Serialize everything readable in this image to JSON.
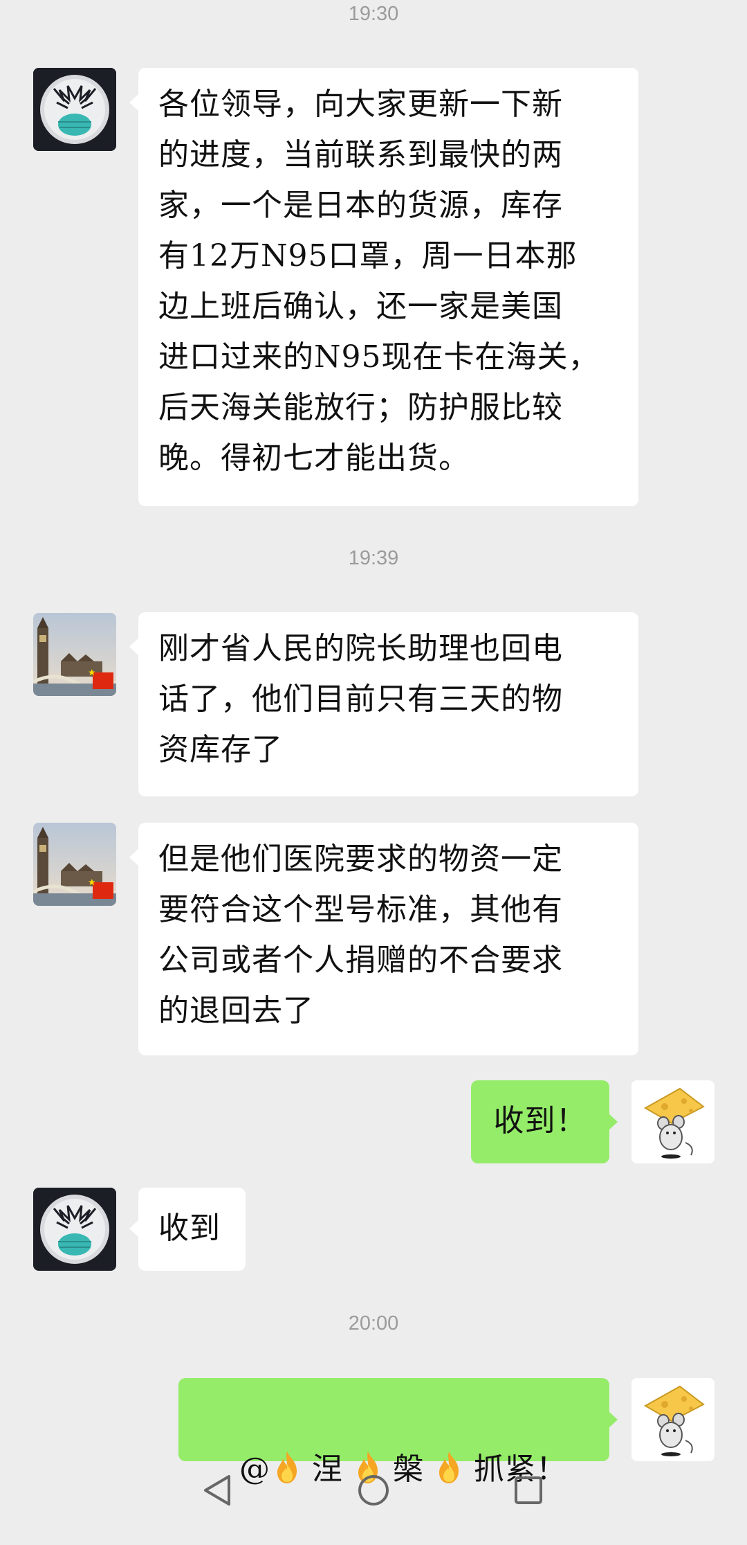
{
  "chat": {
    "messages": [
      {
        "type": "time",
        "text": "19:30"
      },
      {
        "type": "in",
        "sender": "mask-avatar",
        "text": "各位领导，向大家更新一下新\n的进度，当前联系到最快的两\n家，一个是日本的货源，库存\n有12万N95口罩，周一日本那\n边上班后确认，还一家是美国\n进口过来的N95现在卡在海关，\n后天海关能放行；防护服比较\n晚。得初七才能出货。"
      },
      {
        "type": "time",
        "text": "19:39"
      },
      {
        "type": "in",
        "sender": "london-avatar",
        "text": "刚才省人民的院长助理也回电\n话了，他们目前只有三天的物\n资库存了"
      },
      {
        "type": "in",
        "sender": "london-avatar",
        "text": "但是他们医院要求的物资一定\n要符合这个型号标准，其他有\n公司或者个人捐赠的不合要求\n的退回去了"
      },
      {
        "type": "out",
        "sender": "mouse-avatar",
        "text": "收到！"
      },
      {
        "type": "in",
        "sender": "mask-avatar",
        "text": "收到"
      },
      {
        "type": "time",
        "text": "20:00"
      },
      {
        "type": "out",
        "sender": "mouse-avatar",
        "parts": {
          "at": "@",
          "word1": "涅",
          "word2": "槃",
          "word3": "抓紧！"
        },
        "icons": [
          "fire-emoji",
          "fire-emoji",
          "fire-emoji"
        ]
      }
    ]
  },
  "navbar": {
    "icons": [
      "back-triangle-icon",
      "home-circle-icon",
      "recents-square-icon"
    ]
  },
  "colors": {
    "background": "#ededed",
    "incoming_bubble": "#ffffff",
    "outgoing_bubble": "#95ec69",
    "timestamp": "#9b9b9b"
  }
}
